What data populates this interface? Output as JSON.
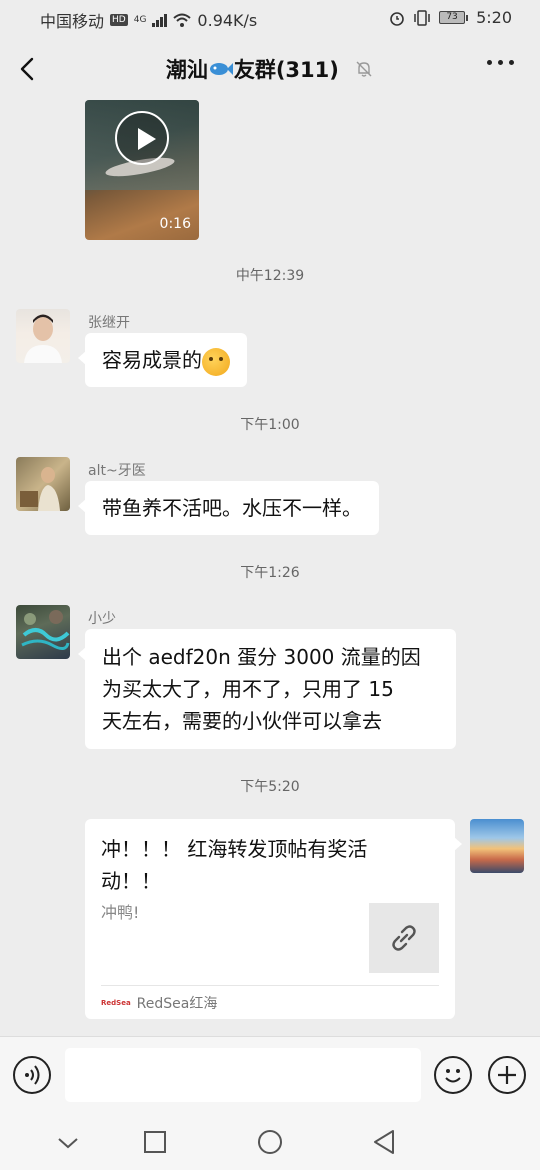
{
  "status_bar": {
    "carrier": "中国移动",
    "hd": "HD",
    "network": "4G",
    "speed": "0.94K/s",
    "battery": "73",
    "time": "5:20"
  },
  "header": {
    "title_prefix": "潮汕",
    "title_suffix": "友群(311)",
    "icons": [
      "back-arrow-icon",
      "fish-icon",
      "mute-bell-icon",
      "more-dots-icon"
    ]
  },
  "video": {
    "duration": "0:16"
  },
  "time_separators": [
    "中午12:39",
    "下午1:00",
    "下午1:26",
    "下午5:20"
  ],
  "messages": [
    {
      "sender": "张继开",
      "text": "容易成景的"
    },
    {
      "sender": "alt~牙医",
      "text": "带鱼养不活吧。水压不一样。"
    },
    {
      "sender": "小少",
      "lines": [
        "出个 aedf20n 蛋分 3000 流量的因",
        "为买太大了，用不了，只用了 15",
        "天左右，需要的小伙伴可以拿去"
      ]
    }
  ],
  "link_card": {
    "title_lines": [
      "冲！！！ 红海转发顶帖有奖活",
      "动！！"
    ],
    "description": "冲鸭!",
    "source": "RedSea红海",
    "source_logo": "RedSea"
  },
  "input_bar": {
    "placeholder": ""
  },
  "colors": {
    "background": "#ededed",
    "bubble": "#ffffff",
    "timestamp": "#666666"
  }
}
